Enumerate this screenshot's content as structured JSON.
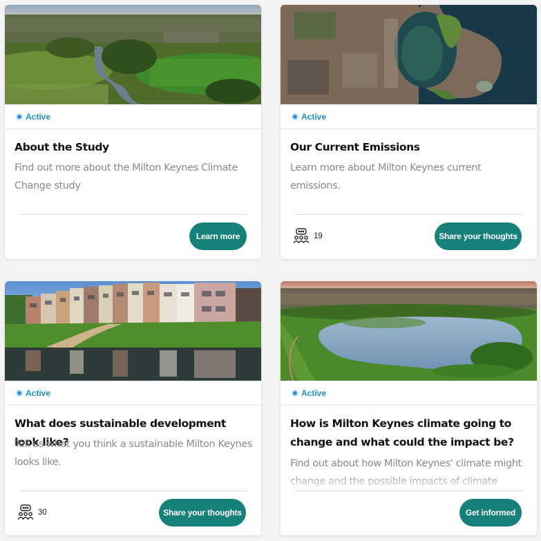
{
  "cards": [
    {
      "status": "Active",
      "title": "About the Study",
      "description": "Find out more about the Milton Keynes Climate Change study",
      "button": "Learn more",
      "comments": ""
    },
    {
      "status": "Active",
      "title": "Our Current Emissions",
      "description": "Learn more about Milton Keynes current emissions.",
      "button": "Share your thoughts",
      "comments": "19"
    },
    {
      "status": "Active",
      "title": "What does sustainable development look like?",
      "description": "Tell us what you think a sustainable Milton Keynes looks like.",
      "button": "Share your thoughts",
      "comments": "30"
    },
    {
      "status": "Active",
      "title": "How is Milton Keynes climate going to change and what could the impact be?",
      "description": "Find out about how Milton Keynes' climate might change and the possible impacts of climate change",
      "button": "Get informed",
      "comments": ""
    }
  ],
  "colors": {
    "accent": "#16807a",
    "status": "#1b8fce"
  },
  "icons": {
    "status": "status-dot-icon",
    "comments": "people-discussion-icon"
  }
}
